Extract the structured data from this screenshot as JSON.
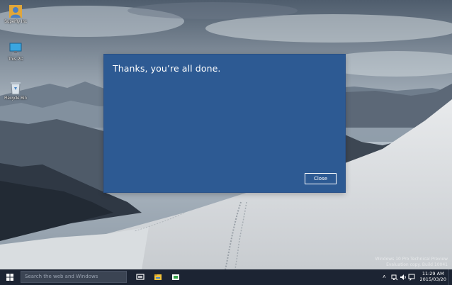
{
  "desktop": {
    "icons": [
      {
        "label": "Superfly Inc",
        "icon": "user-folder-icon"
      },
      {
        "label": "This PC",
        "icon": "computer-icon"
      },
      {
        "label": "Recycle Bin",
        "icon": "recycle-bin-icon"
      }
    ]
  },
  "dialog": {
    "title": "Thanks, you’re all done.",
    "close_label": "Close",
    "background": "#2d5a93"
  },
  "watermark": {
    "line1": "Windows 10 Pro Technical Preview",
    "line2": "Evaluation copy. Build 10041"
  },
  "taskbar": {
    "search_placeholder": "Search the web and Windows",
    "apps": [
      {
        "name": "task-view-icon"
      },
      {
        "name": "file-explorer-icon"
      },
      {
        "name": "store-icon"
      }
    ],
    "tray": {
      "chevron": "˄",
      "time": "11:29 AM",
      "date": "2015/03/20"
    }
  },
  "colors": {
    "accent": "#2d5a93",
    "taskbar": "#1c2433"
  }
}
